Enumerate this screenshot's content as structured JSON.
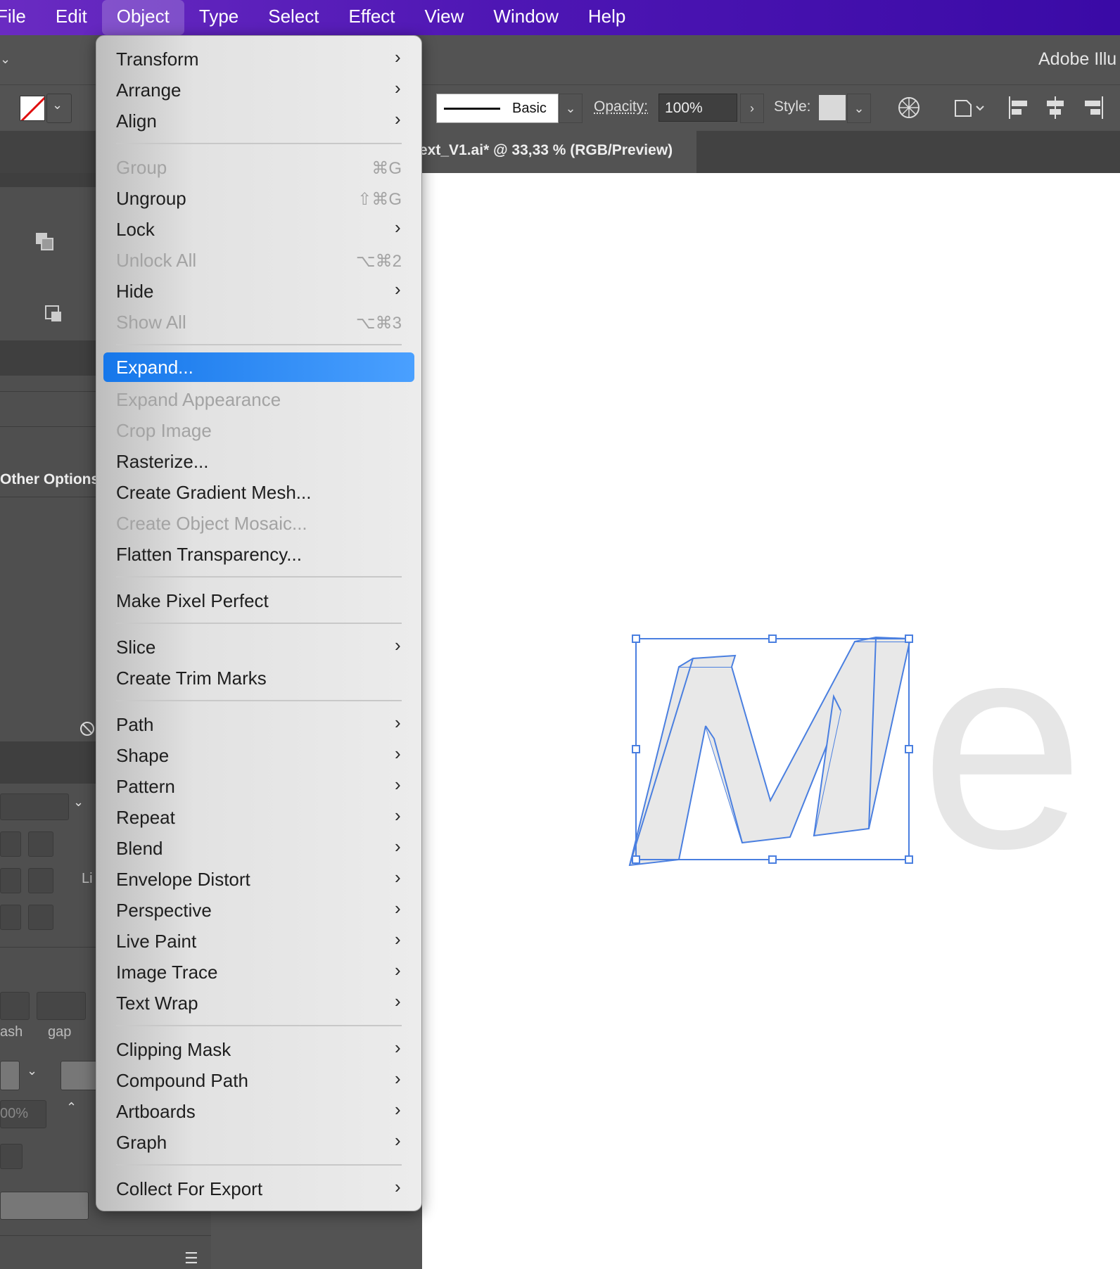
{
  "menubar": {
    "items": [
      {
        "label": "File"
      },
      {
        "label": "Edit"
      },
      {
        "label": "Object"
      },
      {
        "label": "Type"
      },
      {
        "label": "Select"
      },
      {
        "label": "Effect"
      },
      {
        "label": "View"
      },
      {
        "label": "Window"
      },
      {
        "label": "Help"
      }
    ],
    "active": "Object"
  },
  "app": {
    "title": "Adobe Illu"
  },
  "control_bar": {
    "stroke_profile_label": "Basic",
    "opacity_label": "Opacity:",
    "opacity_value": "100%",
    "style_label": "Style:"
  },
  "document": {
    "tab_title": "ext_V1.ai* @ 33,33 % (RGB/Preview)"
  },
  "left_panel": {
    "other_options": "Other Options",
    "label_li": "Li",
    "label_ash": "ash",
    "label_gap": "gap",
    "percent_field": "00%"
  },
  "object_menu": {
    "items": [
      {
        "label": "Transform",
        "submenu": true
      },
      {
        "label": "Arrange",
        "submenu": true
      },
      {
        "label": "Align",
        "submenu": true
      },
      {
        "label": "Group",
        "shortcut": "⌘G",
        "disabled": true
      },
      {
        "label": "Ungroup",
        "shortcut": "⇧⌘G"
      },
      {
        "label": "Lock",
        "submenu": true
      },
      {
        "label": "Unlock All",
        "shortcut": "⌥⌘2",
        "disabled": true
      },
      {
        "label": "Hide",
        "submenu": true
      },
      {
        "label": "Show All",
        "shortcut": "⌥⌘3",
        "disabled": true
      },
      {
        "label": "Expand...",
        "highlighted": true
      },
      {
        "label": "Expand Appearance",
        "disabled": true
      },
      {
        "label": "Crop Image",
        "disabled": true
      },
      {
        "label": "Rasterize..."
      },
      {
        "label": "Create Gradient Mesh..."
      },
      {
        "label": "Create Object Mosaic...",
        "disabled": true
      },
      {
        "label": "Flatten Transparency..."
      },
      {
        "label": "Make Pixel Perfect"
      },
      {
        "label": "Slice",
        "submenu": true
      },
      {
        "label": "Create Trim Marks"
      },
      {
        "label": "Path",
        "submenu": true
      },
      {
        "label": "Shape",
        "submenu": true
      },
      {
        "label": "Pattern",
        "submenu": true
      },
      {
        "label": "Repeat",
        "submenu": true
      },
      {
        "label": "Blend",
        "submenu": true
      },
      {
        "label": "Envelope Distort",
        "submenu": true
      },
      {
        "label": "Perspective",
        "submenu": true
      },
      {
        "label": "Live Paint",
        "submenu": true
      },
      {
        "label": "Image Trace",
        "submenu": true
      },
      {
        "label": "Text Wrap",
        "submenu": true
      },
      {
        "label": "Clipping Mask",
        "submenu": true
      },
      {
        "label": "Compound Path",
        "submenu": true
      },
      {
        "label": "Artboards",
        "submenu": true
      },
      {
        "label": "Graph",
        "submenu": true
      },
      {
        "label": "Collect For Export",
        "submenu": true
      }
    ]
  },
  "canvas": {
    "letter_e": "e"
  },
  "colors": {
    "menubar_start": "#6a2bc2",
    "menubar_end": "#3a0aa6",
    "highlight": "#2b86f5",
    "selection": "#4a7fe0"
  }
}
